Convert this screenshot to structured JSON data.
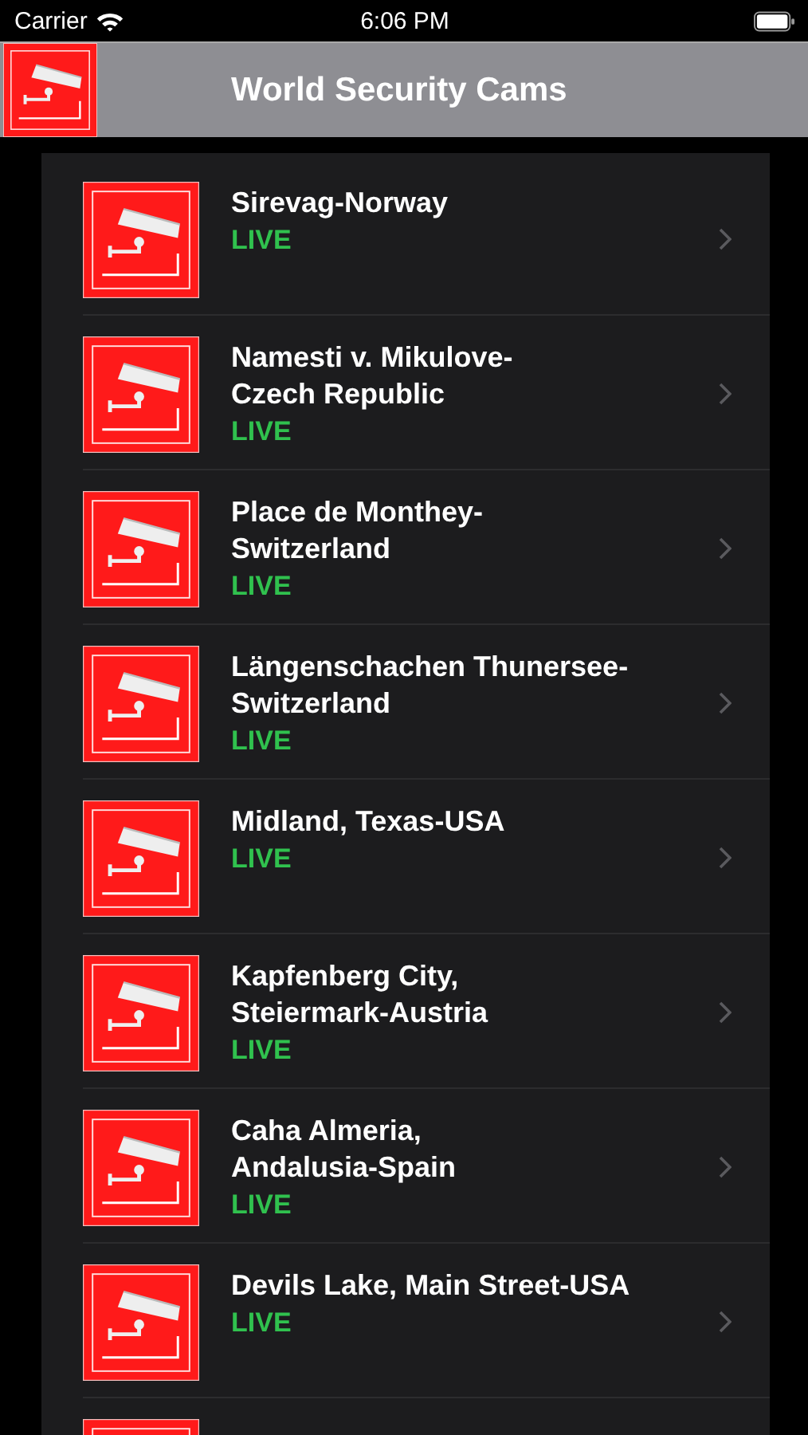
{
  "status_bar": {
    "carrier": "Carrier",
    "time": "6:06 PM"
  },
  "nav": {
    "title": "World Security Cams"
  },
  "cams": [
    {
      "kind": "row",
      "title": "Sirevag-Norway",
      "status": "LIVE"
    },
    {
      "kind": "row",
      "title": "Namesti v. Mikulove-\nCzech Republic",
      "status": "LIVE"
    },
    {
      "kind": "row",
      "title": "Place de Monthey-\nSwitzerland",
      "status": "LIVE"
    },
    {
      "kind": "row",
      "title": "Längenschachen Thunersee-\nSwitzerland",
      "status": "LIVE"
    },
    {
      "kind": "row",
      "title": "Midland, Texas-USA",
      "status": "LIVE"
    },
    {
      "kind": "row",
      "title": "Kapfenberg City,\nSteiermark-Austria",
      "status": "LIVE"
    },
    {
      "kind": "row",
      "title": "Caha Almeria,\nAndalusia-Spain",
      "status": "LIVE"
    },
    {
      "kind": "row",
      "title": "Devils Lake, Main Street-USA",
      "status": "LIVE"
    },
    {
      "kind": "cut"
    }
  ]
}
